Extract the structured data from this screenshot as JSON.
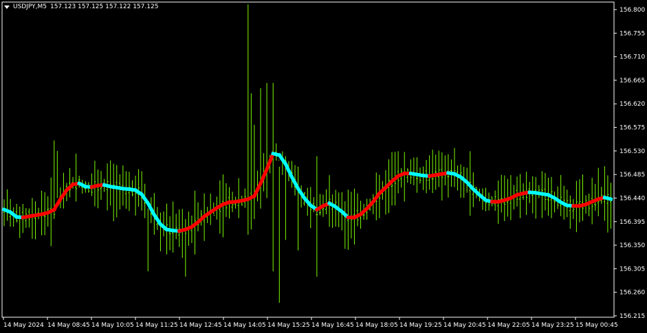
{
  "header": {
    "symbol": "USDJPY,M5",
    "quote": "157.123 157.125 157.122 157.125"
  },
  "colors": {
    "background": "#000000",
    "frame": "#ffffff",
    "candles": "#7cfc00",
    "trend_up": "#ff0000",
    "trend_down": "#00ffff"
  },
  "chart_data": {
    "type": "line",
    "title": "USDJPY,M5",
    "xlabel": "",
    "ylabel": "",
    "ylim": [
      156.215,
      156.83
    ],
    "grid": false,
    "y_ticks": [
      "156.800",
      "156.755",
      "156.710",
      "156.665",
      "156.620",
      "156.575",
      "156.530",
      "156.485",
      "156.440",
      "156.395",
      "156.350",
      "156.305",
      "156.260",
      "156.215"
    ],
    "x_ticks": [
      "14 May 2024",
      "14 May 08:45",
      "14 May 10:05",
      "14 May 11:25",
      "14 May 12:45",
      "14 May 14:05",
      "14 May 15:25",
      "14 May 16:45",
      "14 May 18:05",
      "14 May 19:25",
      "14 May 20:45",
      "14 May 22:05",
      "14 May 23:25",
      "15 May 00:45"
    ],
    "series": [
      {
        "kind": "trend-line",
        "points": [
          [
            0,
            156.418
          ],
          [
            2,
            156.413
          ],
          [
            4,
            156.404
          ],
          [
            6,
            156.403
          ],
          [
            8,
            156.405
          ],
          [
            10,
            156.407
          ],
          [
            12,
            156.409
          ],
          [
            14,
            156.412
          ],
          [
            16,
            156.418
          ],
          [
            18,
            156.438
          ],
          [
            20,
            156.455
          ],
          [
            22,
            156.466
          ],
          [
            24,
            156.468
          ],
          [
            26,
            156.462
          ],
          [
            28,
            156.461
          ],
          [
            30,
            156.464
          ],
          [
            32,
            156.465
          ],
          [
            34,
            156.462
          ],
          [
            36,
            156.46
          ],
          [
            38,
            156.458
          ],
          [
            40,
            156.457
          ],
          [
            42,
            156.455
          ],
          [
            44,
            156.447
          ],
          [
            46,
            156.43
          ],
          [
            48,
            156.408
          ],
          [
            50,
            156.39
          ],
          [
            52,
            156.38
          ],
          [
            54,
            156.378
          ],
          [
            56,
            156.377
          ],
          [
            58,
            156.38
          ],
          [
            60,
            156.385
          ],
          [
            62,
            156.394
          ],
          [
            64,
            156.405
          ],
          [
            66,
            156.413
          ],
          [
            68,
            156.421
          ],
          [
            70,
            156.428
          ],
          [
            72,
            156.432
          ],
          [
            74,
            156.433
          ],
          [
            76,
            156.435
          ],
          [
            78,
            156.438
          ],
          [
            80,
            156.444
          ],
          [
            82,
            156.468
          ],
          [
            84,
            156.495
          ],
          [
            86,
            156.525
          ],
          [
            88,
            156.522
          ],
          [
            90,
            156.505
          ],
          [
            92,
            156.48
          ],
          [
            94,
            156.458
          ],
          [
            96,
            156.44
          ],
          [
            98,
            156.426
          ],
          [
            100,
            156.418
          ],
          [
            102,
            156.425
          ],
          [
            104,
            156.43
          ],
          [
            106,
            156.423
          ],
          [
            108,
            156.414
          ],
          [
            110,
            156.403
          ],
          [
            112,
            156.403
          ],
          [
            114,
            156.409
          ],
          [
            116,
            156.42
          ],
          [
            118,
            156.433
          ],
          [
            120,
            156.449
          ],
          [
            122,
            156.46
          ],
          [
            124,
            156.472
          ],
          [
            126,
            156.482
          ],
          [
            128,
            156.487
          ],
          [
            130,
            156.487
          ],
          [
            132,
            156.485
          ],
          [
            134,
            156.483
          ],
          [
            136,
            156.482
          ],
          [
            138,
            156.484
          ],
          [
            140,
            156.486
          ],
          [
            142,
            156.488
          ],
          [
            144,
            156.486
          ],
          [
            146,
            156.48
          ],
          [
            148,
            156.47
          ],
          [
            150,
            156.457
          ],
          [
            152,
            156.446
          ],
          [
            154,
            156.436
          ],
          [
            156,
            156.433
          ],
          [
            158,
            156.433
          ],
          [
            160,
            156.436
          ],
          [
            162,
            156.44
          ],
          [
            164,
            156.446
          ],
          [
            166,
            156.449
          ],
          [
            168,
            156.451
          ],
          [
            170,
            156.45
          ],
          [
            172,
            156.448
          ],
          [
            174,
            156.446
          ],
          [
            176,
            156.44
          ],
          [
            178,
            156.432
          ],
          [
            180,
            156.426
          ],
          [
            182,
            156.425
          ],
          [
            184,
            156.425
          ],
          [
            186,
            156.428
          ],
          [
            188,
            156.433
          ],
          [
            190,
            156.438
          ],
          [
            192,
            156.441
          ],
          [
            194,
            156.438
          ]
        ]
      }
    ]
  },
  "x_axis_labels": [
    "14 May 2024",
    "14 May 08:45",
    "14 May 10:05",
    "14 May 11:25",
    "14 May 12:45",
    "14 May 14:05",
    "14 May 15:25",
    "14 May 16:45",
    "14 May 18:05",
    "14 May 19:25",
    "14 May 20:45",
    "14 May 22:05",
    "14 May 23:25",
    "15 May 00:45"
  ]
}
